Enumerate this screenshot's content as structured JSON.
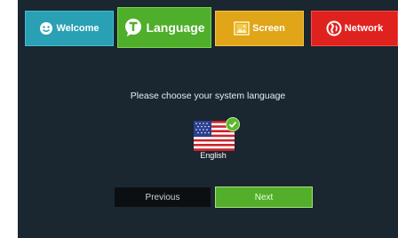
{
  "tabs": {
    "welcome": {
      "label": "Welcome",
      "icon": "smiley-icon",
      "color": "#2aa0b5"
    },
    "language": {
      "label": "Language",
      "icon": "t-bubble-icon",
      "color": "#4fae2a"
    },
    "screen": {
      "label": "Screen",
      "icon": "picture-icon",
      "color": "#e0a518"
    },
    "network": {
      "label": "Network",
      "icon": "globe-icon",
      "color": "#e0221f"
    }
  },
  "main": {
    "prompt": "Please choose your system language",
    "selected_language": "English",
    "flag_icon": "us-flag-icon"
  },
  "buttons": {
    "previous": "Previous",
    "next": "Next"
  }
}
